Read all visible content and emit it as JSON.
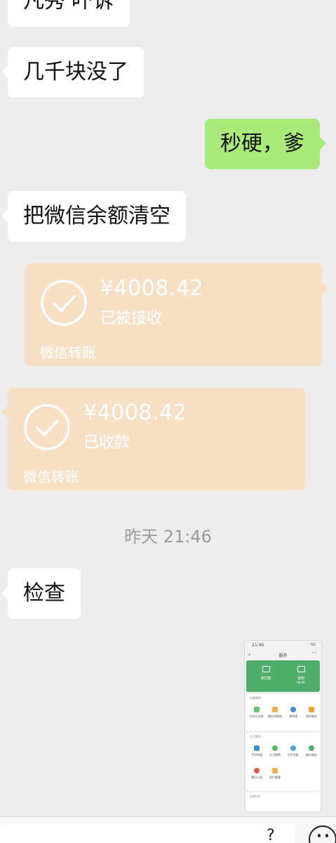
{
  "messages": {
    "top_partial": "凡秀 吓诉",
    "m1": "几千块没了",
    "m2": "秒硬，爹",
    "m3": "把微信余额清空",
    "m4": "检查"
  },
  "transfers": [
    {
      "amount": "¥4008.42",
      "status": "已被接收",
      "label": "微信转账"
    },
    {
      "amount": "¥4008.42",
      "status": "已收款",
      "label": "微信转账"
    }
  ],
  "timestamp": "昨天 21:46",
  "thumbnail": {
    "time": "21:46",
    "signal": "5G",
    "title": "服务",
    "pay_label": "收付款",
    "wallet_label": "钱包",
    "wallet_sub": "¥0.00",
    "section1_title": "金融理财",
    "section1_items": [
      "信用卡还款",
      "微粒贷借钱",
      "理财通",
      "保险服务"
    ],
    "section2_title": "生活服务",
    "section2_items": [
      "手机充值",
      "生活缴费",
      "Q币充值",
      "城市服务",
      "腾讯公益",
      "医疗健康"
    ],
    "section3_title": "交通出行"
  },
  "colors": {
    "background": "#ededed",
    "incoming_bubble": "#ffffff",
    "outgoing_bubble": "#a9ea7a",
    "transfer_card": "#f7e0c5",
    "timestamp_text": "#9b9b9b",
    "thumbnail_green": "#4fae6c"
  },
  "icons": {
    "transfer_status": "check-circle-icon",
    "input_right": "emoji-icon"
  }
}
